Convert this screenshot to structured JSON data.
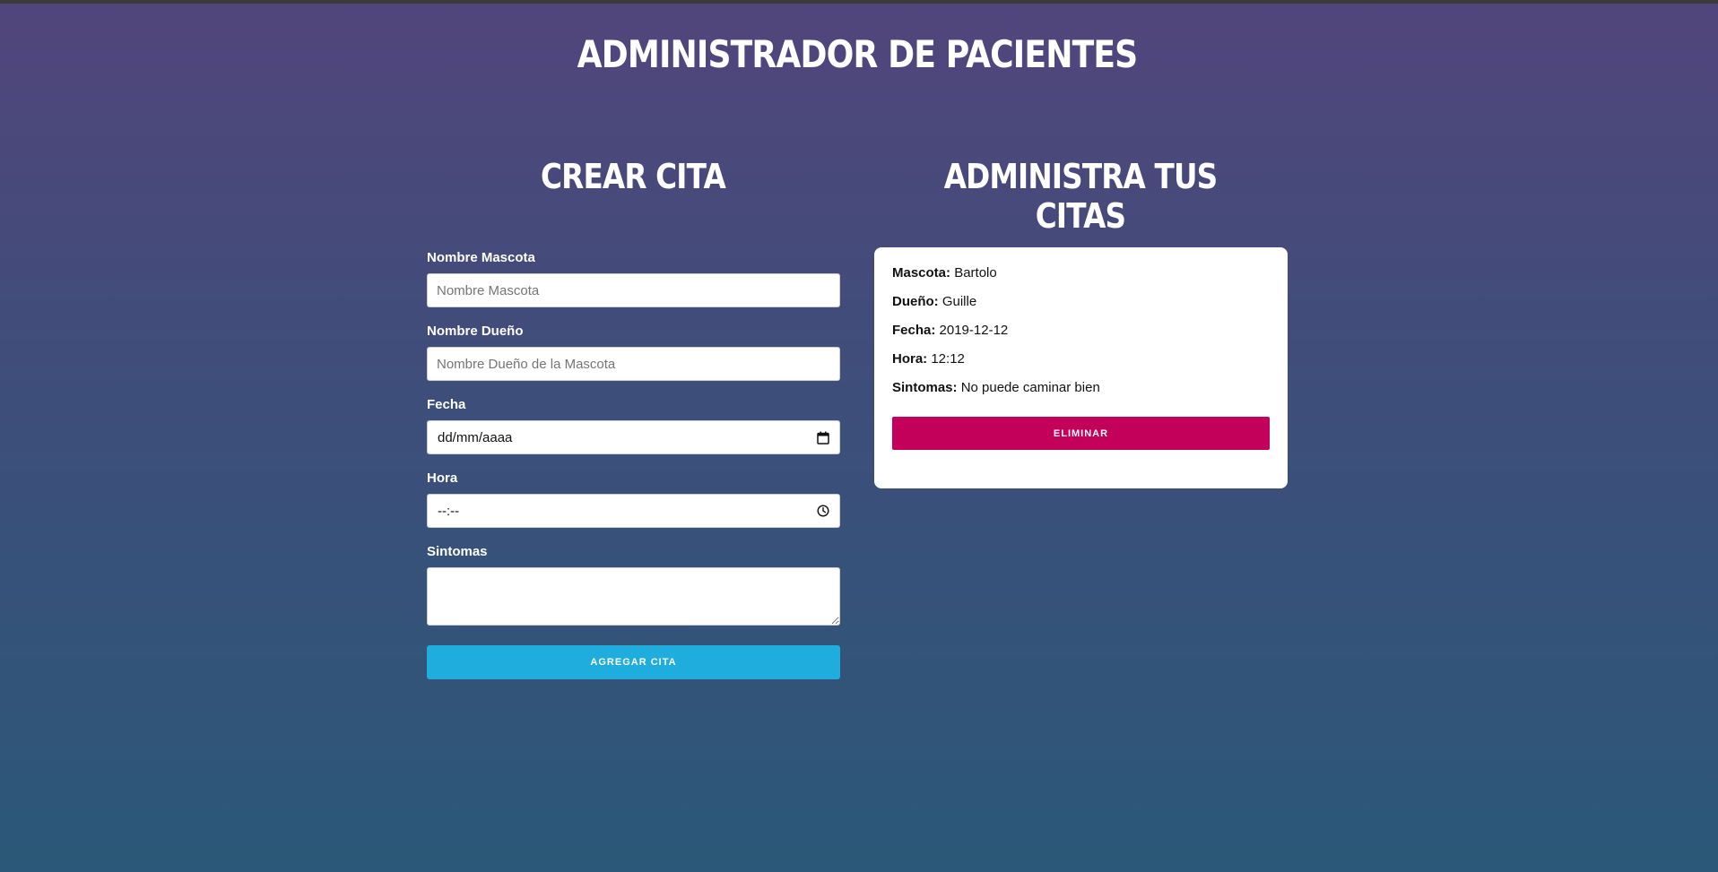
{
  "app": {
    "title": "ADMINISTRADOR DE PACIENTES"
  },
  "create_section": {
    "title": "CREAR CITA",
    "fields": {
      "pet_name": {
        "label": "Nombre Mascota",
        "placeholder": "Nombre Mascota",
        "value": ""
      },
      "owner_name": {
        "label": "Nombre Dueño",
        "placeholder": "Nombre Dueño de la Mascota",
        "value": ""
      },
      "date": {
        "label": "Fecha",
        "display": "dd/mm/aaaa",
        "icon": "calendar-icon"
      },
      "time": {
        "label": "Hora",
        "display": "--:--",
        "icon": "clock-icon"
      },
      "symptoms": {
        "label": "Sintomas",
        "value": ""
      }
    },
    "submit_label": "AGREGAR CITA"
  },
  "manage_section": {
    "title": "ADMINISTRA TUS CITAS",
    "appointments": [
      {
        "pet_label": "Mascota:",
        "pet": "Bartolo",
        "owner_label": "Dueño:",
        "owner": "Guille",
        "date_label": "Fecha:",
        "date": "2019-12-12",
        "time_label": "Hora:",
        "time": "12:12",
        "symptoms_label": "Sintomas:",
        "symptoms": "No puede caminar bien",
        "delete_label": "ELIMINAR"
      }
    ]
  },
  "colors": {
    "submit_button": "#1fadde",
    "delete_button": "#c3005a",
    "background_top": "#51457c",
    "background_bottom": "#2b5878"
  }
}
